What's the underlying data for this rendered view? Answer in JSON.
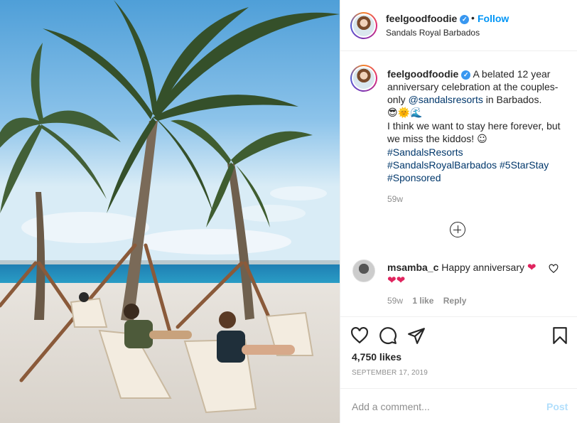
{
  "header": {
    "username": "feelgoodfoodie",
    "dot": "•",
    "follow_label": "Follow",
    "location": "Sandals Royal Barbados"
  },
  "caption": {
    "username": "feelgoodfoodie",
    "text1": "A belated 12 year anniversary celebration at the couples-only",
    "mention": "@sandalsresorts",
    "text2": "in Barbados.",
    "emojis1": "😎🌞🌊",
    "text3": "I think we want to stay here forever, but we miss the kiddos!",
    "emoji2": "☺",
    "hashtag1": "#SandalsResorts",
    "hashtag2": "#SandalsRoyalBarbados",
    "hashtag3": "#5StarStay",
    "hashtag4": "#Sponsored",
    "time": "59w"
  },
  "comment": {
    "username": "msamba_c",
    "text": "Happy anniversary",
    "hearts": "❤",
    "hearts2": "❤❤",
    "time": "59w",
    "likes": "1 like",
    "reply": "Reply"
  },
  "actions": {
    "likes": "4,750 likes",
    "date": "SEPTEMBER 17, 2019"
  },
  "add_comment": {
    "placeholder": "Add a comment...",
    "post_label": "Post"
  },
  "colors": {
    "link": "#00376b",
    "follow": "#0095f6",
    "post_disabled": "#b2dffc",
    "heart": "#e0245e"
  }
}
